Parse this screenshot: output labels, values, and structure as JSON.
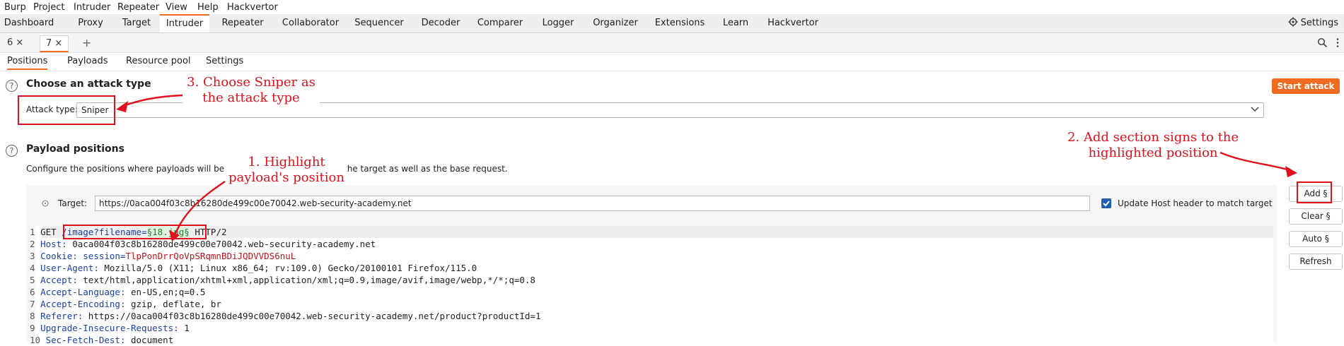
{
  "menu": [
    "Burp",
    "Project",
    "Intruder",
    "Repeater",
    "View",
    "Help",
    "Hackvertor"
  ],
  "main_tabs": [
    "Dashboard",
    "Proxy",
    "Target",
    "Intruder",
    "Repeater",
    "Collaborator",
    "Sequencer",
    "Decoder",
    "Comparer",
    "Logger",
    "Organizer",
    "Extensions",
    "Learn",
    "Hackvertor"
  ],
  "settings_label": "Settings",
  "instance_tabs": [
    {
      "label": "6 ×"
    },
    {
      "label": "7 ×"
    }
  ],
  "add_tab": "+",
  "sub_tabs": [
    "Positions",
    "Payloads",
    "Resource pool",
    "Settings"
  ],
  "attack": {
    "heading": "Choose an attack type",
    "type_label": "Attack type:",
    "type_value": "Sniper",
    "start_button": "Start attack"
  },
  "positions": {
    "heading": "Payload positions",
    "description_left": "Configure the positions where payloads will be in",
    "description_right": "the target as well as the base request.",
    "target_label": "Target:",
    "target_value": "https://0aca004f03c8b16280de499c00e70042.web-security-academy.net",
    "update_host_label": "Update Host header to match target",
    "update_host_checked": true
  },
  "side_buttons": [
    "Add §",
    "Clear §",
    "Auto §",
    "Refresh"
  ],
  "request": {
    "line1": {
      "num": "1",
      "method": "GET ",
      "path": "/image?",
      "param": "filename",
      "eq": "=",
      "payload": "§18.jpg§",
      "proto": " HTTP/2"
    },
    "lines": [
      {
        "num": "2",
        "name": "Host:",
        "value": " 0aca004f03c8b16280de499c00e70042.web-security-academy.net"
      },
      {
        "num": "3",
        "name": "Cookie:",
        "value": " session=",
        "cookie": "TlpPonDrrQoVpSRqmnBDiJQDVVDS6nuL"
      },
      {
        "num": "4",
        "name": "User-Agent:",
        "value": " Mozilla/5.0 (X11; Linux x86_64; rv:109.0) Gecko/20100101 Firefox/115.0"
      },
      {
        "num": "5",
        "name": "Accept:",
        "value": " text/html,application/xhtml+xml,application/xml;q=0.9,image/avif,image/webp,*/*;q=0.8"
      },
      {
        "num": "6",
        "name": "Accept-Language:",
        "value": " en-US,en;q=0.5"
      },
      {
        "num": "7",
        "name": "Accept-Encoding:",
        "value": " gzip, deflate, br"
      },
      {
        "num": "8",
        "name": "Referer:",
        "value": " https://0aca004f03c8b16280de499c00e70042.web-security-academy.net/product?productId=1"
      },
      {
        "num": "9",
        "name": "Upgrade-Insecure-Requests:",
        "value": " 1"
      },
      {
        "num": "10",
        "name": "Sec-Fetch-Dest:",
        "value": " document"
      }
    ]
  },
  "annotations": {
    "step1": "1. Highlight\npayload's position",
    "step2": "2. Add section signs to the\nhighlighted position",
    "step3": "3. Choose Sniper as\nthe attack type"
  },
  "colors": {
    "accent": "#f06a20",
    "annotation_red": "#e0101c"
  }
}
